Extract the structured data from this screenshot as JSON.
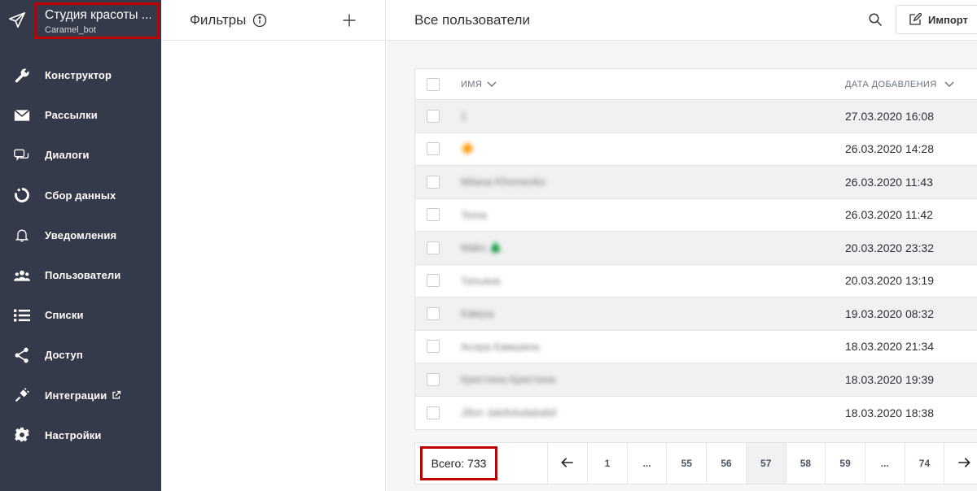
{
  "sidebar": {
    "brand_title": "Студия красоты ...",
    "brand_subtitle": "Caramel_bot",
    "items": [
      {
        "label": "Конструктор",
        "icon": "wrench-icon"
      },
      {
        "label": "Рассылки",
        "icon": "envelope-icon"
      },
      {
        "label": "Диалоги",
        "icon": "chat-icon"
      },
      {
        "label": "Сбор данных",
        "icon": "ring-chart-icon"
      },
      {
        "label": "Уведомления",
        "icon": "bell-icon"
      },
      {
        "label": "Пользователи",
        "icon": "users-icon"
      },
      {
        "label": "Списки",
        "icon": "list-icon"
      },
      {
        "label": "Доступ",
        "icon": "share-icon"
      },
      {
        "label": "Интеграции",
        "icon": "plug-icon"
      },
      {
        "label": "Настройки",
        "icon": "gear-icon"
      }
    ]
  },
  "filters": {
    "title": "Фильтры"
  },
  "main": {
    "title": "Все пользователи",
    "import_label": "Импорт"
  },
  "table": {
    "col_name": "ИМЯ",
    "col_date": "ДАТА ДОБАВЛЕНИЯ",
    "rows": [
      {
        "name": "1",
        "date": "27.03.2020 16:08"
      },
      {
        "name": "🔶",
        "date": "26.03.2020 14:28"
      },
      {
        "name": "Milana Khomenko",
        "date": "26.03.2020 11:43"
      },
      {
        "name": "Toma",
        "date": "26.03.2020 11:42"
      },
      {
        "name": "Maks 🌲",
        "date": "20.03.2020 23:32"
      },
      {
        "name": "Татьяна",
        "date": "20.03.2020 13:19"
      },
      {
        "name": "Камуш",
        "date": "19.03.2020 08:32"
      },
      {
        "name": "Асора Камшина",
        "date": "18.03.2020 21:34"
      },
      {
        "name": "Кристина Кристина",
        "date": "18.03.2020 19:39"
      },
      {
        "name": "Jifon Jakifolodababil",
        "date": "18.03.2020 18:38"
      }
    ]
  },
  "pager": {
    "total": "Всего: 733",
    "pages": [
      "1",
      "...",
      "55",
      "56",
      "57",
      "58",
      "59",
      "...",
      "74"
    ],
    "active": "57"
  },
  "colors": {
    "sidebar_bg": "#343a4a",
    "highlight": "#c00000"
  }
}
